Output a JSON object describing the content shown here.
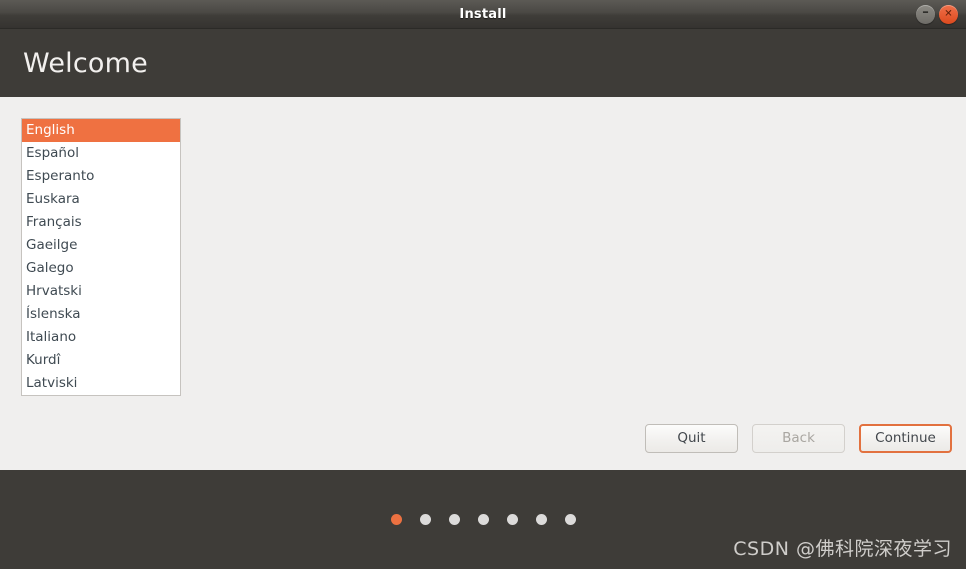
{
  "window": {
    "title": "Install",
    "controls": [
      {
        "name": "minimize",
        "glyph": "–"
      },
      {
        "name": "close",
        "glyph": "✕"
      }
    ]
  },
  "header": {
    "title": "Welcome"
  },
  "language_list": {
    "selected": "English",
    "items": [
      "English",
      "Español",
      "Esperanto",
      "Euskara",
      "Français",
      "Gaeilge",
      "Galego",
      "Hrvatski",
      "Íslenska",
      "Italiano",
      "Kurdî",
      "Latviski"
    ]
  },
  "nav": {
    "quit_label": "Quit",
    "back_label": "Back",
    "continue_label": "Continue"
  },
  "footer": {
    "steps": {
      "total": 7,
      "active_index": 0
    },
    "watermark": "CSDN @佛科院深夜学习"
  },
  "colors": {
    "accent": "#E95420",
    "selection": "#ef7141",
    "header_dark": "#3e3c38",
    "content_bg": "#f0efee"
  }
}
